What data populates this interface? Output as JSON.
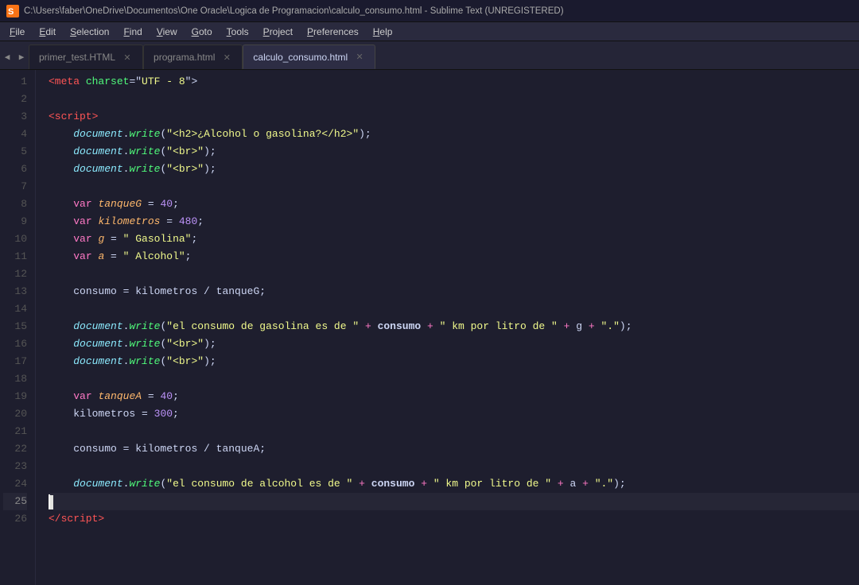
{
  "titleBar": {
    "text": "C:\\Users\\faber\\OneDrive\\Documentos\\One Oracle\\Logica de Programacion\\calculo_consumo.html - Sublime Text (UNREGISTERED)"
  },
  "menuBar": {
    "items": [
      "File",
      "Edit",
      "Selection",
      "Find",
      "View",
      "Goto",
      "Tools",
      "Project",
      "Preferences",
      "Help"
    ]
  },
  "tabs": [
    {
      "label": "primer_test.HTML",
      "active": false
    },
    {
      "label": "programa.html",
      "active": false
    },
    {
      "label": "calculo_consumo.html",
      "active": true
    }
  ],
  "lineNumbers": [
    1,
    2,
    3,
    4,
    5,
    6,
    7,
    8,
    9,
    10,
    11,
    12,
    13,
    14,
    15,
    16,
    17,
    18,
    19,
    20,
    21,
    22,
    23,
    24,
    25,
    26
  ]
}
